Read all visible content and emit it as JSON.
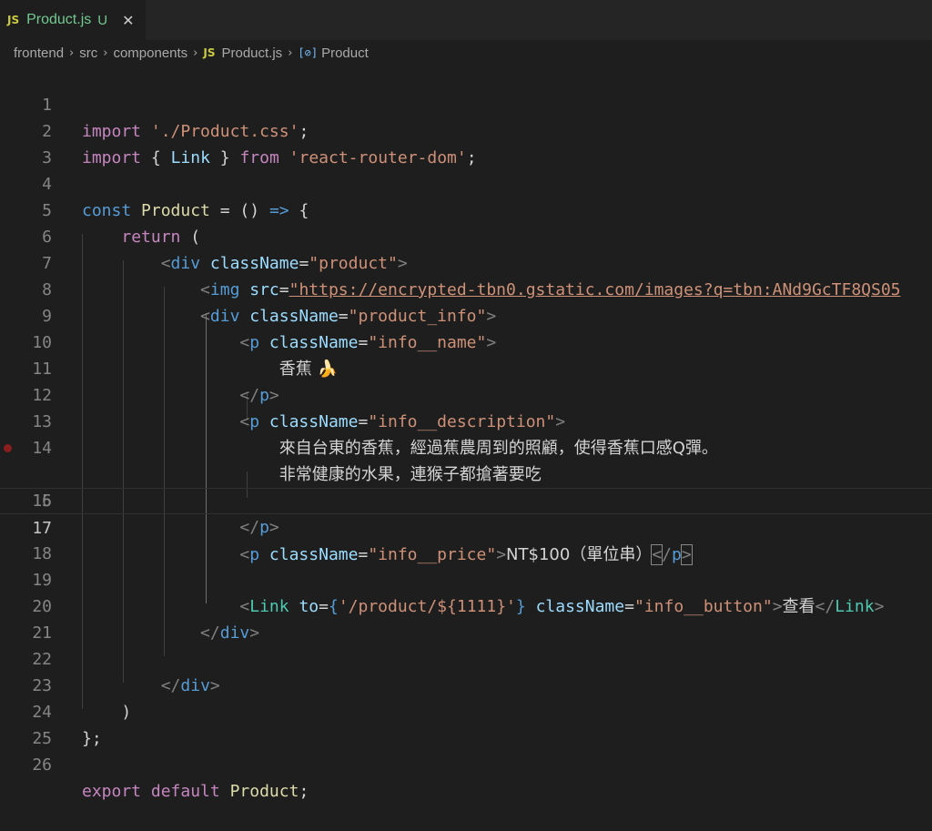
{
  "tab": {
    "badge": "JS",
    "name": "Product.js",
    "status": "U",
    "close": "✕"
  },
  "breadcrumb": {
    "folder1": "frontend",
    "folder2": "src",
    "folder3": "components",
    "file_badge": "JS",
    "file": "Product.js",
    "symbol_icon": "[⊘]",
    "symbol": "Product",
    "sep": "›"
  },
  "line_numbers": [
    "1",
    "2",
    "3",
    "4",
    "5",
    "6",
    "7",
    "8",
    "9",
    "10",
    "11",
    "12",
    "13",
    "14",
    "15",
    "16",
    "17",
    "18",
    "19",
    "20",
    "21",
    "22",
    "23",
    "24",
    "25",
    "26"
  ],
  "code": {
    "l1": {
      "kw": "import",
      "str": "'./Product.css'",
      "end": ";"
    },
    "l2": {
      "kw": "import",
      "b1": "{",
      "name": "Link",
      "b2": "}",
      "from": "from",
      "str": "'react-router-dom'",
      "end": ";"
    },
    "l4": {
      "const": "const",
      "name": "Product",
      "eq": "=",
      "paren": "()",
      "arrow": "=>",
      "brace": "{"
    },
    "l5": {
      "kw": "return",
      "paren": "("
    },
    "l6": {
      "open": "<",
      "tag": "div",
      "attr": "className",
      "eq": "=",
      "val": "\"product\"",
      "close": ">"
    },
    "l7": {
      "open": "<",
      "tag": "img",
      "attr": "src",
      "eq": "=",
      "val": "\"https://encrypted-tbn0.gstatic.com/images?q=tbn:ANd9GcTF8QS05"
    },
    "l8": {
      "open": "<",
      "tag": "div",
      "attr": "className",
      "eq": "=",
      "val": "\"product_info\"",
      "close": ">"
    },
    "l9": {
      "open": "<",
      "tag": "p",
      "attr": "className",
      "eq": "=",
      "val": "\"info__name\"",
      "close": ">"
    },
    "l10": {
      "text": "香蕉 🍌"
    },
    "l11": {
      "open": "</",
      "tag": "p",
      "close": ">"
    },
    "l12": {
      "open": "<",
      "tag": "p",
      "attr": "className",
      "eq": "=",
      "val": "\"info__description\"",
      "close": ">"
    },
    "l13": {
      "text": "來自台東的香蕉，經過蕉農周到的照顧，使得香蕉口感Q彈。"
    },
    "l14": {
      "text": "非常健康的水果，連猴子都搶著要吃"
    },
    "l15": {
      "open": "</",
      "tag": "p",
      "close": ">"
    },
    "l17": {
      "open": "<",
      "tag": "p",
      "attr": "className",
      "eq": "=",
      "val": "\"info__price\"",
      "close": ">",
      "text": "NT$100（單位串）",
      "copen": "<",
      "cslash": "/",
      "ctag": "p",
      "cclose": ">"
    },
    "l19": {
      "open": "<",
      "tag": "Link",
      "attr": "to",
      "eq": "=",
      "b1": "{",
      "val": "'/product/${1111}'",
      "b2": "}",
      "attr2": "className",
      "eq2": "=",
      "val2": "\"info__button\"",
      "close": ">",
      "text": "查看",
      "copen": "</",
      "ctag": "Link",
      "cclose": ">"
    },
    "l20": {
      "open": "</",
      "tag": "div",
      "close": ">"
    },
    "l22": {
      "open": "</",
      "tag": "div",
      "close": ">"
    },
    "l23": {
      "paren": ")"
    },
    "l24": {
      "brace": "};"
    },
    "l26": {
      "kw1": "export",
      "kw2": "default",
      "name": "Product",
      "end": ";"
    }
  },
  "colors": {
    "background": "#1e1e1e",
    "keyword": "#c586c0",
    "string": "#ce9178",
    "tag": "#569cd6",
    "attribute": "#9cdcfe",
    "component": "#4ec9b0"
  }
}
